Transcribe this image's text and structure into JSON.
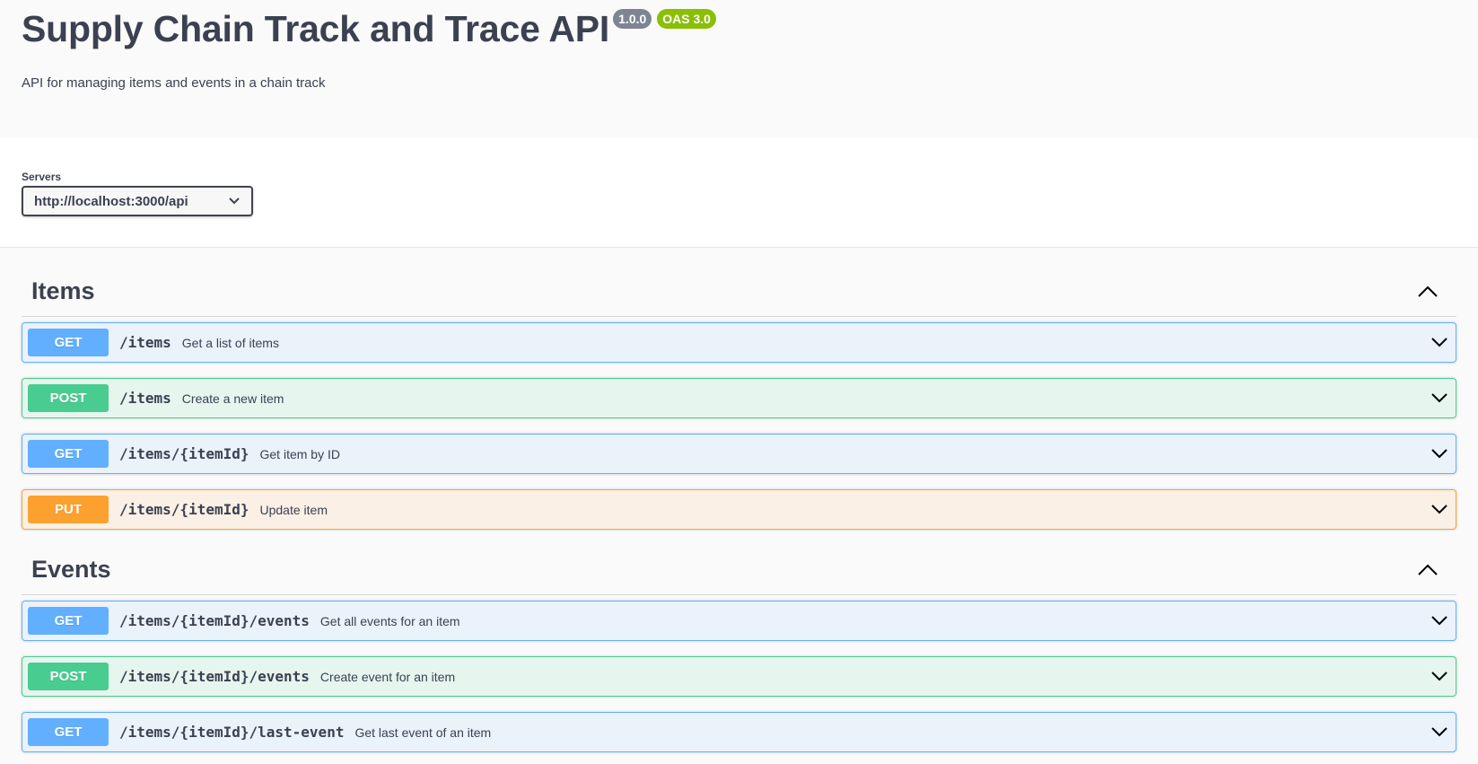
{
  "info": {
    "title": "Supply Chain Track and Trace API",
    "version": "1.0.0",
    "oas": "OAS 3.0",
    "description": "API for managing items and events in a chain track"
  },
  "servers": {
    "label": "Servers",
    "selected": "http://localhost:3000/api"
  },
  "tags": [
    {
      "name": "Items",
      "operations": [
        {
          "method": "GET",
          "path": "/items",
          "summary": "Get a list of items"
        },
        {
          "method": "POST",
          "path": "/items",
          "summary": "Create a new item"
        },
        {
          "method": "GET",
          "path": "/items/{itemId}",
          "summary": "Get item by ID"
        },
        {
          "method": "PUT",
          "path": "/items/{itemId}",
          "summary": "Update item"
        }
      ]
    },
    {
      "name": "Events",
      "operations": [
        {
          "method": "GET",
          "path": "/items/{itemId}/events",
          "summary": "Get all events for an item"
        },
        {
          "method": "POST",
          "path": "/items/{itemId}/events",
          "summary": "Create event for an item"
        },
        {
          "method": "GET",
          "path": "/items/{itemId}/last-event",
          "summary": "Get last event of an item"
        }
      ]
    }
  ],
  "colors": {
    "get": "#61affe",
    "post": "#49cc90",
    "put": "#fca130",
    "text": "#3b4151"
  },
  "icons": {
    "tag_toggle": "chevron-up-icon",
    "op_toggle": "chevron-down-icon",
    "select_toggle": "chevron-down-icon"
  }
}
